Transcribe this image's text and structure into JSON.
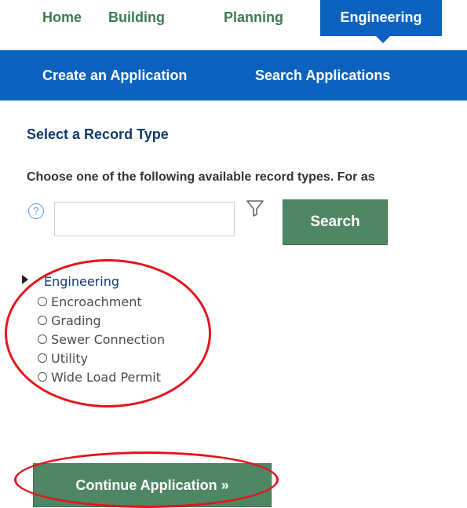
{
  "nav": {
    "tabs": [
      {
        "label": "Home"
      },
      {
        "label": "Building"
      },
      {
        "label": "Planning"
      },
      {
        "label": "Engineering",
        "active": true
      }
    ]
  },
  "subnav": {
    "create_label": "Create an Application",
    "search_label": "Search Applications"
  },
  "page": {
    "title": "Select a Record Type",
    "instructions": "Choose one of the following available record types. For as"
  },
  "search": {
    "help_icon": "?",
    "input_value": "",
    "filter_icon_name": "filter-icon",
    "button_label": "Search"
  },
  "record_types": {
    "category": "Engineering",
    "options": [
      {
        "label": "Encroachment",
        "selected": false
      },
      {
        "label": "Grading",
        "selected": false
      },
      {
        "label": "Sewer Connection",
        "selected": false
      },
      {
        "label": "Utility",
        "selected": false
      },
      {
        "label": "Wide Load Permit",
        "selected": false
      }
    ]
  },
  "actions": {
    "continue_label": "Continue Application »"
  },
  "colors": {
    "primary_blue": "#0a62be",
    "button_green": "#4f8663",
    "tab_green": "#3f7a4d",
    "annotation_red": "#e3141b"
  }
}
